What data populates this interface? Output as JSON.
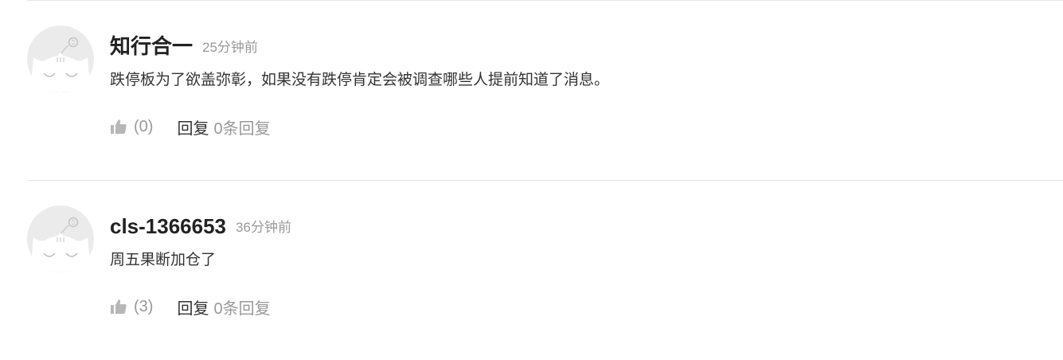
{
  "comments": [
    {
      "author": "知行合一",
      "time": "25分钟前",
      "text": "跌停板为了欲盖弥彰，如果没有跌停肯定会被调查哪些人提前知道了消息。",
      "likes": "(0)",
      "reply_label": "回复",
      "reply_count": "0条回复"
    },
    {
      "author": "cls-1366653",
      "time": "36分钟前",
      "text": "周五果断加仓了",
      "likes": "(3)",
      "reply_label": "回复",
      "reply_count": "0条回复"
    }
  ],
  "icons": {
    "avatar": "default-avatar-icon",
    "like": "thumbs-up-icon"
  },
  "colors": {
    "author": "#222222",
    "muted": "#999999",
    "text": "#333333",
    "divider": "#e5e5e5",
    "avatar_bg": "#ebebeb"
  }
}
